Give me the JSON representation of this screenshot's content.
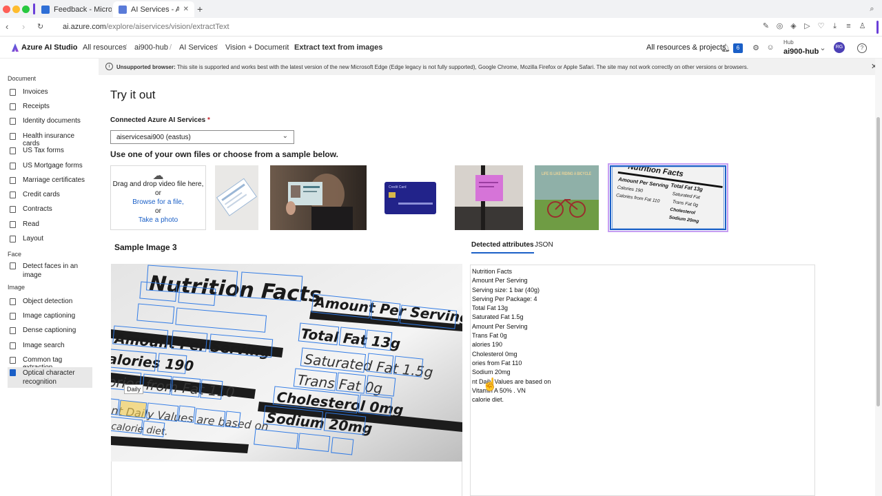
{
  "browser": {
    "tabs": [
      {
        "label": "Feedback - Microsoft A"
      },
      {
        "label": "AI Services - Azure AI S"
      }
    ],
    "url_host": "ai.azure.com",
    "url_path": "/explore/aiservices/vision/extractText"
  },
  "header": {
    "brand": "Azure AI Studio",
    "breadcrumbs": [
      "All resources",
      "ai900-hub",
      "AI Services",
      "Vision + Document",
      "Extract text from images"
    ],
    "all_resources_projects": "All resources & projects",
    "notification_count": "6",
    "hub_label": "Hub",
    "hub_name": "ai900-hub",
    "avatar_initials": "RG"
  },
  "sidebar": {
    "groups": [
      {
        "title": "Document",
        "items": [
          "Invoices",
          "Receipts",
          "Identity documents",
          "Health insurance cards",
          "US Tax forms",
          "US Mortgage forms",
          "Marriage certificates",
          "Credit cards",
          "Contracts",
          "Read",
          "Layout"
        ]
      },
      {
        "title": "Face",
        "items": [
          "Detect faces in an image"
        ]
      },
      {
        "title": "Image",
        "items": [
          "Object detection",
          "Image captioning",
          "Dense captioning",
          "Image search",
          "Common tag extraction",
          "Optical character recognition"
        ]
      }
    ],
    "selected": "Optical character recognition"
  },
  "banner": {
    "bold": "Unsupported browser:",
    "text": "This site is supported and works best with the latest version of the new Microsoft Edge (Edge legacy is not fully supported), Google Chrome, Mozilla Firefox or Apple Safari. The site may not work correctly on other versions or browsers."
  },
  "main": {
    "title": "Try it out",
    "connected_label": "Connected Azure AI Services",
    "required_mark": "*",
    "selected_service": "aiservicesai900 (eastus)",
    "hint": "Use one of your own files or choose from a sample below.",
    "dropzone": {
      "line1": "Drag and drop video file here,",
      "or1": "or",
      "browse": "Browse for a file,",
      "or2": "or",
      "photo": "Take a photo"
    },
    "sample_title": "Sample Image 3",
    "result_tabs": [
      "Detected attributes",
      "JSON"
    ],
    "tooltip": "Daily",
    "detected_lines": [
      "Nutrition Facts",
      "Amount Per Serving",
      "Serving size: 1 bar (40g)",
      "Serving Per Package: 4",
      "Total Fat 13g",
      "Saturated Fat 1.5g",
      "Amount Per Serving",
      "Trans Fat 0g",
      "alories 190",
      "Cholesterol 0mg",
      "ories from Fat 110",
      "Sodium 20mg",
      "nt Daily Values are based on",
      "Vitamin A 50% . VN",
      "calorie diet."
    ],
    "thumbnail_text": {
      "card": "Credit Card",
      "poster": "LIFE IS LIKE RIDING A BICYCLE",
      "nutrition": [
        "Nutrition Facts",
        "Amount Per Serving",
        "Total Fat 13g",
        "Saturated Fat",
        "Trans Fat 0g",
        "Cholesterol",
        "Sodium 20mg",
        "Calories 190",
        "Calories from Fat 110"
      ]
    }
  }
}
